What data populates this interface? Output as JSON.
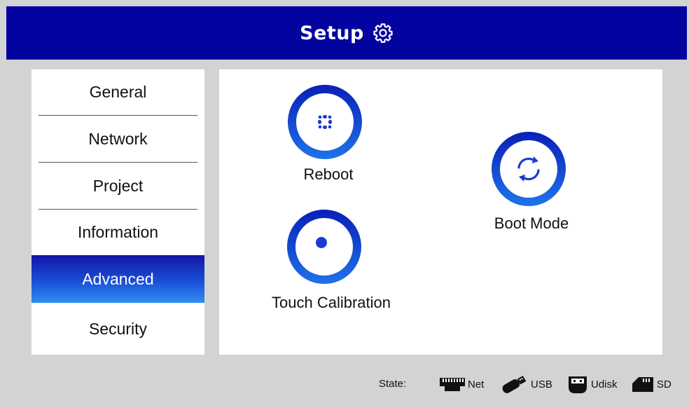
{
  "header": {
    "title": "Setup",
    "icon": "gear-icon"
  },
  "sidebar": {
    "items": [
      {
        "label": "General",
        "active": false
      },
      {
        "label": "Network",
        "active": false
      },
      {
        "label": "Project",
        "active": false
      },
      {
        "label": "Information",
        "active": false
      },
      {
        "label": "Advanced",
        "active": true
      },
      {
        "label": "Security",
        "active": false
      }
    ]
  },
  "main": {
    "tiles": [
      {
        "label": "Reboot",
        "icon": "reboot-icon"
      },
      {
        "label": "Boot Mode",
        "icon": "refresh-cycle-icon"
      },
      {
        "label": "Touch Calibration",
        "icon": "touch-calibration-icon"
      }
    ]
  },
  "status": {
    "label": "State:",
    "items": [
      {
        "label": "Net",
        "icon": "ethernet-port-icon"
      },
      {
        "label": "USB",
        "icon": "usb-drive-icon"
      },
      {
        "label": "Udisk",
        "icon": "udisk-icon"
      },
      {
        "label": "SD",
        "icon": "sd-card-icon"
      }
    ]
  },
  "colors": {
    "header_bg": "#0303a0",
    "accent_top": "#0a1fb8",
    "accent_bottom": "#1f73e8",
    "background": "#d3d3d3"
  }
}
